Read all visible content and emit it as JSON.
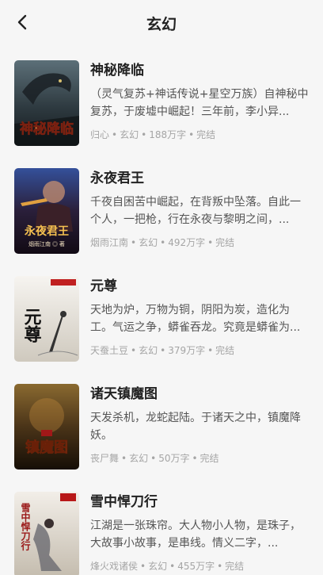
{
  "header": {
    "back_icon": "chevron-left-icon",
    "title": "玄幻"
  },
  "books": [
    {
      "title": "神秘降临",
      "description": "（灵气复苏+神话传说+星空万族）自神秘中复苏，于废墟中崛起！三年前，李小异...",
      "author": "归心",
      "category": "玄幻",
      "word_count": "188万字",
      "status": "完结",
      "cover_text": "神秘降临",
      "cover_colors": [
        "#3a4a52",
        "#1c2228"
      ]
    },
    {
      "title": "永夜君王",
      "description": "千夜自困苦中崛起，在背叛中坠落。自此一个人，一把枪，行在永夜与黎明之间，...",
      "author": "烟雨江南",
      "category": "玄幻",
      "word_count": "492万字",
      "status": "完结",
      "cover_text": "永夜君王",
      "cover_subtext": "烟雨江南 ◎ 著",
      "cover_colors": [
        "#2a3f7a",
        "#1a1024"
      ]
    },
    {
      "title": "元尊",
      "description": "天地为炉，万物为铜，阴阳为炭，造化为工。气运之争，蟒雀吞龙。究竟是蟒雀为...",
      "author": "天蚕土豆",
      "category": "玄幻",
      "word_count": "379万字",
      "status": "完结",
      "cover_text": "元尊",
      "cover_colors": [
        "#f2f0ec",
        "#d8d4cc"
      ]
    },
    {
      "title": "诸天镇魔图",
      "description": "天发杀机，龙蛇起陆。于诸天之中，镇魔降妖。",
      "author": "丧尸舞",
      "category": "玄幻",
      "word_count": "50万字",
      "status": "完结",
      "cover_text": "镇魔图",
      "cover_colors": [
        "#6b4a1e",
        "#1e1408"
      ]
    },
    {
      "title": "雪中悍刀行",
      "description": "江湖是一张珠帘。大人物小人物，是珠子，大故事小故事，是串线。情义二字，...",
      "author": "烽火戏诸侯",
      "category": "玄幻",
      "word_count": "455万字",
      "status": "完结",
      "cover_text": "雪中悍刀行",
      "cover_colors": [
        "#eeeae4",
        "#c8c0b4"
      ]
    }
  ]
}
